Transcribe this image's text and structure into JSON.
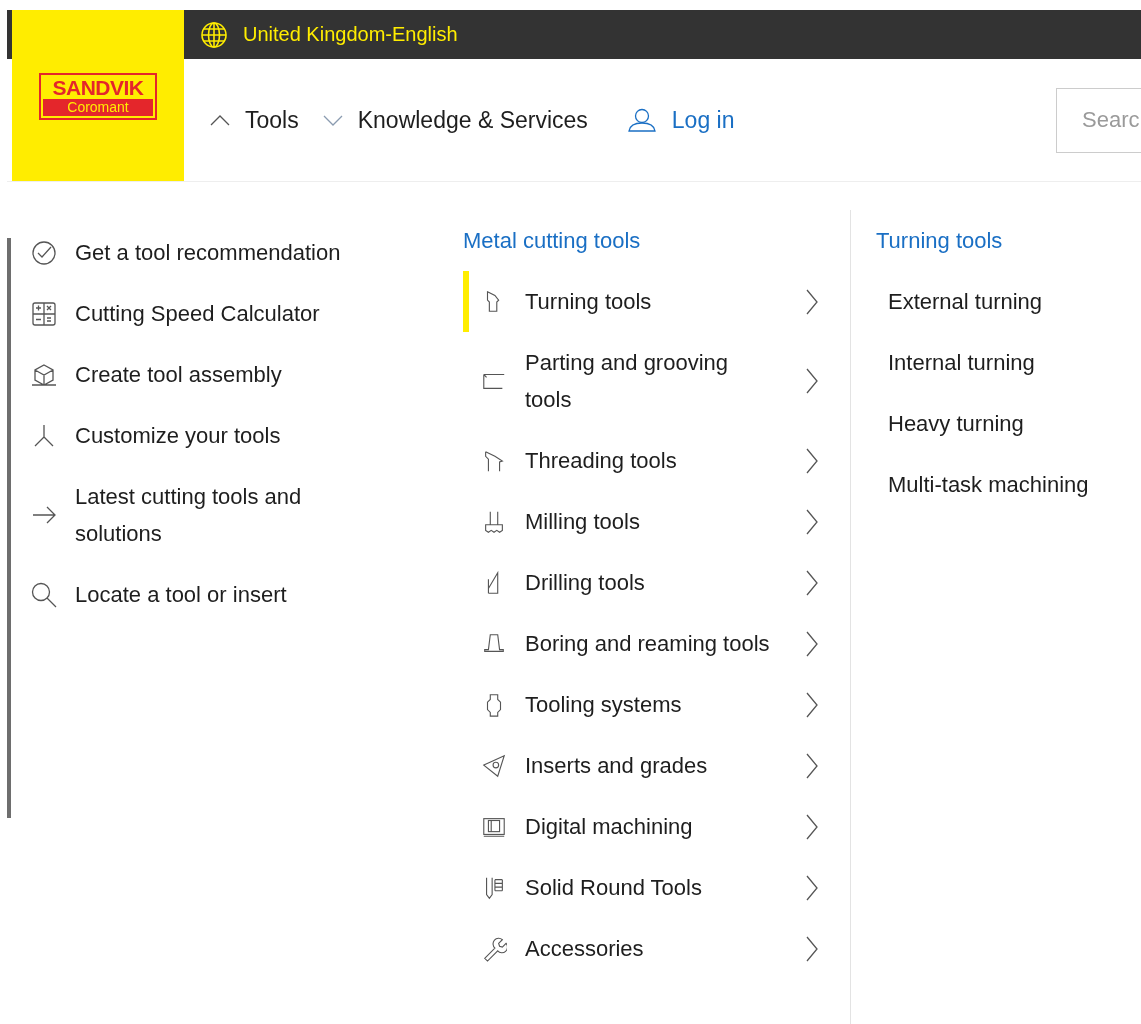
{
  "top_bar": {
    "language": "United Kingdom-English"
  },
  "logo": {
    "brand": "SANDVIK",
    "sub": "Coromant"
  },
  "nav": [
    {
      "label": "Tools",
      "expanded": true
    },
    {
      "label": "Knowledge & Services",
      "expanded": false
    }
  ],
  "login": "Log in",
  "search": {
    "placeholder": "Searc"
  },
  "quick_links": [
    "Get a tool recommendation",
    "Cutting Speed Calculator",
    "Create tool assembly",
    "Customize your tools",
    "Latest cutting tools and solutions",
    "Locate a tool or insert"
  ],
  "categories": {
    "title": "Metal cutting tools",
    "items": [
      {
        "label": "Turning tools",
        "selected": true
      },
      {
        "label": "Parting and grooving tools",
        "selected": false
      },
      {
        "label": "Threading tools",
        "selected": false
      },
      {
        "label": "Milling tools",
        "selected": false
      },
      {
        "label": "Drilling tools",
        "selected": false
      },
      {
        "label": "Boring and reaming tools",
        "selected": false
      },
      {
        "label": "Tooling systems",
        "selected": false
      },
      {
        "label": "Inserts and grades",
        "selected": false
      },
      {
        "label": "Digital machining",
        "selected": false
      },
      {
        "label": "Solid Round Tools",
        "selected": false
      },
      {
        "label": "Accessories",
        "selected": false
      }
    ]
  },
  "subcategories": {
    "title": "Turning tools",
    "items": [
      "External turning",
      "Internal turning",
      "Heavy turning",
      "Multi-task machining"
    ]
  }
}
